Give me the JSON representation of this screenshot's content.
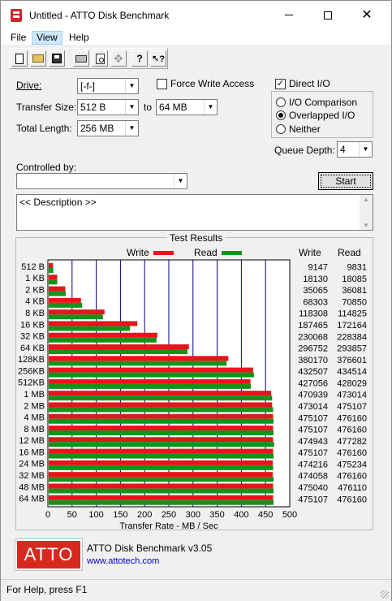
{
  "window": {
    "title": "Untitled - ATTO Disk Benchmark",
    "icon": "disk-app-icon"
  },
  "menu": [
    "File",
    "View",
    "Help"
  ],
  "toolbar_icons": [
    "new-document-icon",
    "open-folder-icon",
    "save-icon",
    "print-icon",
    "print-preview-icon",
    "move-icon",
    "help-icon",
    "context-help-icon"
  ],
  "form": {
    "drive_label": "Drive:",
    "drive_value": "[-f-]",
    "force_write_label": "Force Write Access",
    "force_write_checked": false,
    "direct_io_label": "Direct I/O",
    "direct_io_checked": true,
    "transfer_size_label": "Transfer Size:",
    "transfer_from": "512 B",
    "to_label": "to",
    "transfer_to": "64 MB",
    "total_length_label": "Total Length:",
    "total_length": "256 MB",
    "io_comparison_label": "I/O Comparison",
    "overlapped_io_label": "Overlapped I/O",
    "neither_label": "Neither",
    "selected_mode": "Overlapped I/O",
    "queue_depth_label": "Queue Depth:",
    "queue_depth": "4",
    "controlled_by_label": "Controlled by:",
    "controlled_by_value": "",
    "start_label": "Start",
    "description": "<< Description >>"
  },
  "results": {
    "group_title": "Test Results",
    "write_legend": "Write",
    "read_legend": "Read",
    "write_col": "Write",
    "read_col": "Read",
    "colors": {
      "write": "#e8141b",
      "read": "#15921a",
      "grid": "#000080"
    }
  },
  "chart_data": {
    "type": "bar",
    "orientation": "horizontal",
    "xlabel": "Transfer Rate - MB / Sec",
    "xlim": [
      0,
      500
    ],
    "xticks": [
      "0",
      "50",
      "100",
      "150",
      "200",
      "250",
      "300",
      "350",
      "400",
      "450",
      "500"
    ],
    "categories": [
      "512 B",
      "1 KB",
      "2 KB",
      "4 KB",
      "8 KB",
      "16 KB",
      "32 KB",
      "64 KB",
      "128KB",
      "256KB",
      "512KB",
      "1 MB",
      "2 MB",
      "4 MB",
      "8 MB",
      "12 MB",
      "16 MB",
      "24 MB",
      "32 MB",
      "48 MB",
      "64 MB"
    ],
    "series": [
      {
        "name": "Write",
        "values": [
          8.9,
          17.7,
          34.2,
          66.7,
          115.6,
          183.1,
          224.7,
          289.8,
          371.3,
          422.4,
          417.1,
          459.9,
          461.9,
          463.9,
          463.9,
          463.8,
          463.9,
          463.1,
          463.0,
          463.9,
          463.9
        ],
        "labels": [
          "9147",
          "18130",
          "35065",
          "68303",
          "118308",
          "187465",
          "230068",
          "296752",
          "380170",
          "432507",
          "427056",
          "470939",
          "473014",
          "475107",
          "475107",
          "474943",
          "475107",
          "474216",
          "474058",
          "475040",
          "475107"
        ]
      },
      {
        "name": "Read",
        "values": [
          9.6,
          17.7,
          35.2,
          69.2,
          112.1,
          168.1,
          223.0,
          287.0,
          367.8,
          424.3,
          418.0,
          461.9,
          463.9,
          465.0,
          465.0,
          466.1,
          465.0,
          464.1,
          465.0,
          464.9,
          465.0
        ],
        "labels": [
          "9831",
          "18085",
          "36081",
          "70850",
          "114825",
          "172164",
          "228384",
          "293857",
          "376601",
          "434514",
          "428029",
          "473014",
          "475107",
          "476160",
          "476160",
          "477282",
          "476160",
          "475234",
          "476160",
          "476110",
          "476160"
        ]
      }
    ]
  },
  "banner": {
    "logo_text": "ATTO",
    "app_name": "ATTO Disk Benchmark v3.05",
    "url": "www.attotech.com"
  },
  "status": "For Help, press F1"
}
